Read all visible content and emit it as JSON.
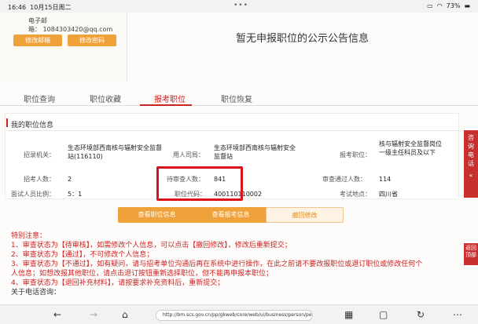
{
  "status": {
    "time": "16:46",
    "date": "10月15日周二",
    "dots": "•••",
    "battery": "73%"
  },
  "account": {
    "email_label": "电子邮箱：",
    "email": "1084303420@qq.com",
    "btn_change_email": "修改邮箱",
    "btn_change_password": "修改密码"
  },
  "notice": "暂无申报职位的公示公告信息",
  "tabs": [
    "职位查询",
    "职位收藏",
    "报考职位",
    "职位恢复"
  ],
  "section_title": "我的职位信息",
  "info": {
    "dept_label": "招录机关：",
    "dept_value": "生态环境部西南核与辐射安全监督站(116110)",
    "employer_label": "用人司局：",
    "employer_value": "生态环境部西南核与辐射安全监督站",
    "position_label": "报考职位：",
    "position_value": "核与辐射安全监督岗位一级主任科员及以下",
    "count_label": "招考人数：",
    "count_value": "2",
    "pending_label": "待审查人数：",
    "pending_value": "841",
    "passed_label": "审查通过人数：",
    "passed_value": "114",
    "ratio_label": "面试人员比例：",
    "ratio_value": "5：1",
    "code_label": "职位代码：",
    "code_value": "400110110002",
    "location_label": "考试地点：",
    "location_value": "四川省"
  },
  "buttons": {
    "view_position": "查看职位信息",
    "view_application": "查看报考信息",
    "withdraw": "撤回修改"
  },
  "notes": {
    "heading": "特别注意：",
    "l1a": "1、审查状态为【待审核】，如需修改个人信息，可以点击【撤回修改】，修改后重新提交；",
    "l2a": "2、审查状态为【通过】，不可修改个人信息；",
    "l3a": "3、审查状态为【不通过】，如有疑问，请与招考单位沟通后再在系统中进行操作，在此之前请不要改报职位或退订职位或修改任何个",
    "l3b": "人信息；如想改报其他职位，请点击退订按钮重新选择职位，但不能再申报本职位；",
    "l4a": "4、审查状态为【退回补充材料】，请按要求补充资料后，重新提交；",
    "l5a": "关于电话咨询："
  },
  "side": {
    "consult": "咨询电话",
    "top": "返回顶部"
  },
  "browser": {
    "url": "http://bm.scs.gov.cn/pp/gkweb/core/web/ui/business/person/person_hom..."
  },
  "colors": {
    "accent": "#c22",
    "orange": "#f0a23a",
    "highlight": "#d9121b"
  }
}
